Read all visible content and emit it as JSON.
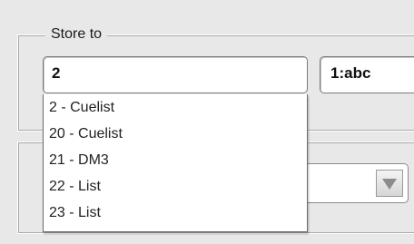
{
  "store_group": {
    "legend": "Store to",
    "target_value": "2",
    "name_value": "1:abc"
  },
  "dropdown": {
    "items": [
      "2 - Cuelist",
      "20 - Cuelist",
      "21 - DM3",
      "22 - List",
      "23 - List"
    ]
  },
  "second_group": {
    "combo_value": ""
  },
  "icons": {
    "combo_arrow": "triangle-down-icon"
  }
}
